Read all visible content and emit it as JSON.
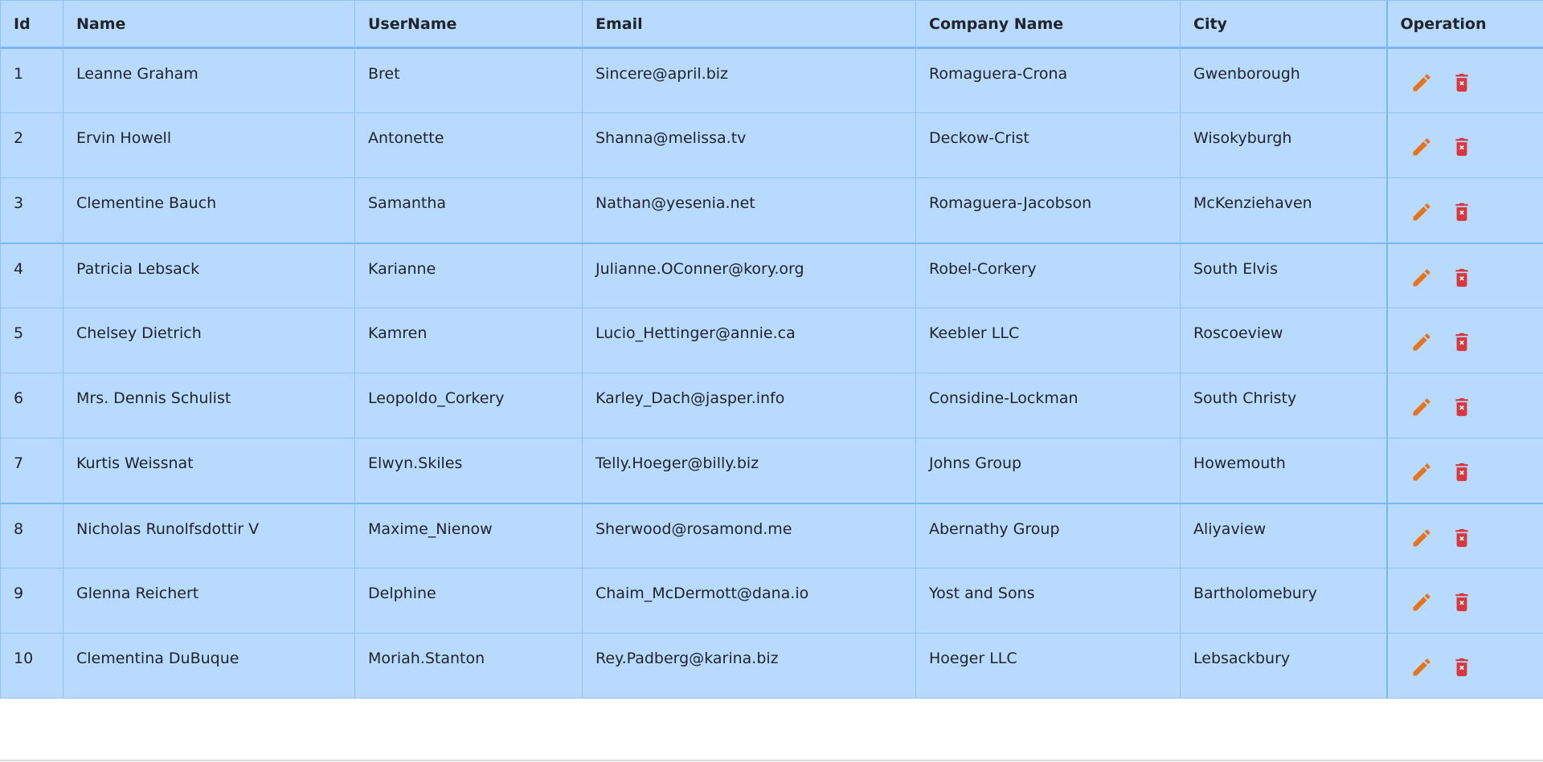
{
  "table": {
    "headers": {
      "id": "Id",
      "name": "Name",
      "username": "UserName",
      "email": "Email",
      "company": "Company Name",
      "city": "City",
      "operation": "Operation"
    },
    "rows": [
      {
        "id": "1",
        "name": "Leanne Graham",
        "username": "Bret",
        "email": "Sincere@april.biz",
        "company": "Romaguera-Crona",
        "city": "Gwenborough"
      },
      {
        "id": "2",
        "name": "Ervin Howell",
        "username": "Antonette",
        "email": "Shanna@melissa.tv",
        "company": "Deckow-Crist",
        "city": "Wisokyburgh"
      },
      {
        "id": "3",
        "name": "Clementine Bauch",
        "username": "Samantha",
        "email": "Nathan@yesenia.net",
        "company": "Romaguera-Jacobson",
        "city": "McKenziehaven"
      },
      {
        "id": "4",
        "name": "Patricia Lebsack",
        "username": "Karianne",
        "email": "Julianne.OConner@kory.org",
        "company": "Robel-Corkery",
        "city": "South Elvis"
      },
      {
        "id": "5",
        "name": "Chelsey Dietrich",
        "username": "Kamren",
        "email": "Lucio_Hettinger@annie.ca",
        "company": "Keebler LLC",
        "city": "Roscoeview"
      },
      {
        "id": "6",
        "name": "Mrs. Dennis Schulist",
        "username": "Leopoldo_Corkery",
        "email": "Karley_Dach@jasper.info",
        "company": "Considine-Lockman",
        "city": "South Christy"
      },
      {
        "id": "7",
        "name": "Kurtis Weissnat",
        "username": "Elwyn.Skiles",
        "email": "Telly.Hoeger@billy.biz",
        "company": "Johns Group",
        "city": "Howemouth"
      },
      {
        "id": "8",
        "name": "Nicholas Runolfsdottir V",
        "username": "Maxime_Nienow",
        "email": "Sherwood@rosamond.me",
        "company": "Abernathy Group",
        "city": "Aliyaview"
      },
      {
        "id": "9",
        "name": "Glenna Reichert",
        "username": "Delphine",
        "email": "Chaim_McDermott@dana.io",
        "company": "Yost and Sons",
        "city": "Bartholomebury"
      },
      {
        "id": "10",
        "name": "Clementina DuBuque",
        "username": "Moriah.Stanton",
        "email": "Rey.Padberg@karina.biz",
        "company": "Hoeger LLC",
        "city": "Lebsackbury"
      }
    ],
    "icons": {
      "edit": "pencil-icon",
      "delete": "trash-icon"
    },
    "colors": {
      "row_background": "#b8daff",
      "border": "#8fc1f5",
      "edit_icon": "#e8741a",
      "delete_icon": "#d9363e"
    }
  }
}
